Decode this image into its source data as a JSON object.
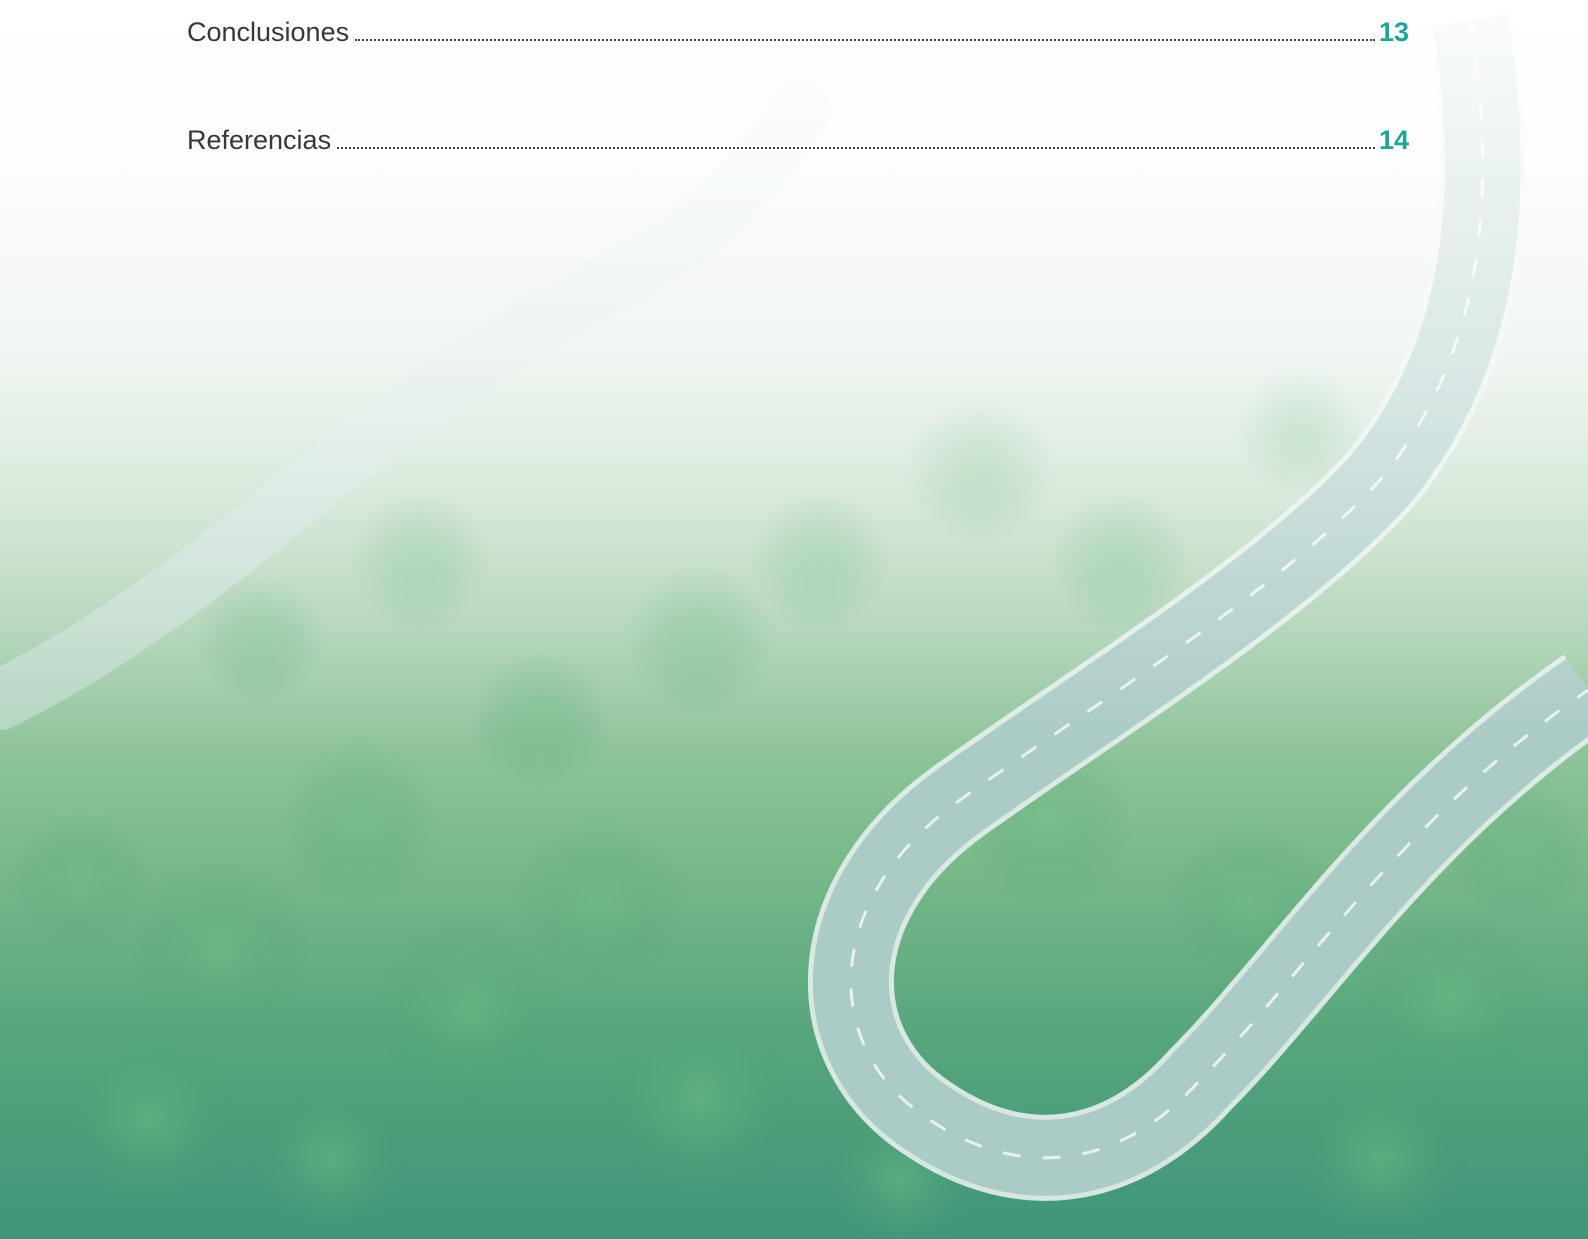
{
  "toc": {
    "entries": [
      {
        "title": "Conclusiones",
        "page": "13"
      },
      {
        "title": "Referencias",
        "page": "14"
      }
    ]
  },
  "colors": {
    "text": "#333a38",
    "page_number": "#1ea596",
    "forest_dark": "#3f957a",
    "road": "#a8c9c4"
  },
  "background": {
    "description_icon": "aerial-forest-road-image"
  }
}
